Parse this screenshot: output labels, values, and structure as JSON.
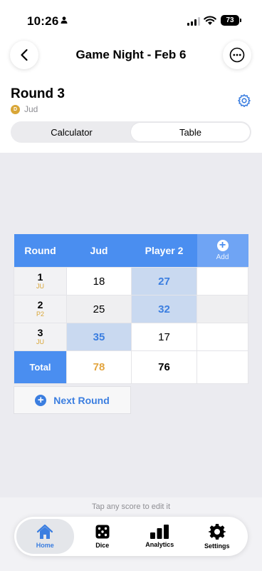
{
  "status": {
    "time": "10:26",
    "battery": "73"
  },
  "header": {
    "title": "Game Night - Feb 6"
  },
  "round": {
    "title": "Round 3",
    "dealer_initial": "D",
    "dealer_name": "Jud"
  },
  "view_toggle": {
    "options": [
      "Calculator",
      "Table"
    ],
    "selected": "Table"
  },
  "table": {
    "headers": {
      "round": "Round",
      "player1": "Jud",
      "player2": "Player 2",
      "add": "Add"
    },
    "rows": [
      {
        "round": "1",
        "dealer": "JU",
        "p1": "18",
        "p2": "27"
      },
      {
        "round": "2",
        "dealer": "P2",
        "p1": "25",
        "p2": "32"
      },
      {
        "round": "3",
        "dealer": "JU",
        "p1": "35",
        "p2": "17"
      }
    ],
    "total": {
      "label": "Total",
      "p1": "78",
      "p2": "76"
    },
    "next_round": "Next Round"
  },
  "hint": "Tap any score to edit it",
  "tabs": {
    "home": "Home",
    "dice": "Dice",
    "analytics": "Analytics",
    "settings": "Settings"
  },
  "colors": {
    "accent": "#4a8ef0",
    "highlight": "#3b7ee0",
    "dealer": "#d9a637",
    "total_leader": "#e3a53f"
  }
}
